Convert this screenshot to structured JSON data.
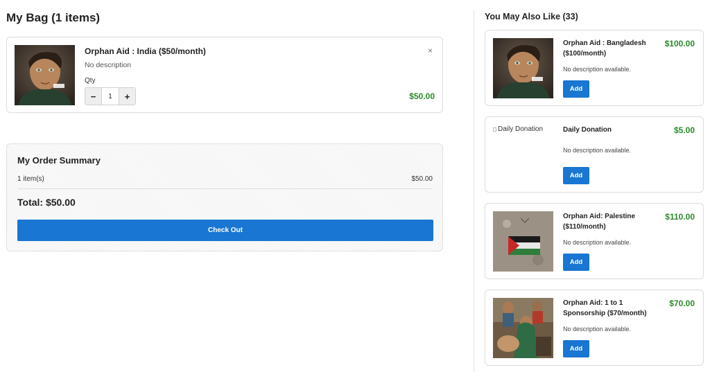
{
  "bag": {
    "title": "My Bag (1 items)",
    "items": [
      {
        "image": "boy-portrait-photo",
        "name": "Orphan Aid : India ($50/month)",
        "description": "No description",
        "qty_label": "Qty",
        "qty": "1",
        "minus": "−",
        "plus": "+",
        "remove": "×",
        "price": "$50.00"
      }
    ]
  },
  "summary": {
    "title": "My Order Summary",
    "count": "1 item(s)",
    "subtotal": "$50.00",
    "total": "Total: $50.00",
    "checkout": "Check Out"
  },
  "recommendations": {
    "title": "You May Also Like (33)",
    "items": [
      {
        "image": "boy-portrait-photo",
        "name": "Orphan Aid : Bangladesh ($100/month)",
        "price": "$100.00",
        "description": "No description available.",
        "add": "Add"
      },
      {
        "image": "broken-image",
        "image_alt": "Daily Donation",
        "name": "Daily Donation",
        "price": "$5.00",
        "description": "No description available.",
        "add": "Add"
      },
      {
        "image": "palestine-flag-wall-photo",
        "name": "Orphan Aid: Palestine ($110/month)",
        "price": "$110.00",
        "description": "No description available.",
        "add": "Add"
      },
      {
        "image": "children-photo",
        "name": "Orphan Aid: 1 to 1 Sponsorship ($70/month)",
        "price": "$70.00",
        "description": "No description available.",
        "add": "Add"
      }
    ]
  },
  "colors": {
    "accent": "#1976d2",
    "price_green": "#2a8a2a"
  }
}
